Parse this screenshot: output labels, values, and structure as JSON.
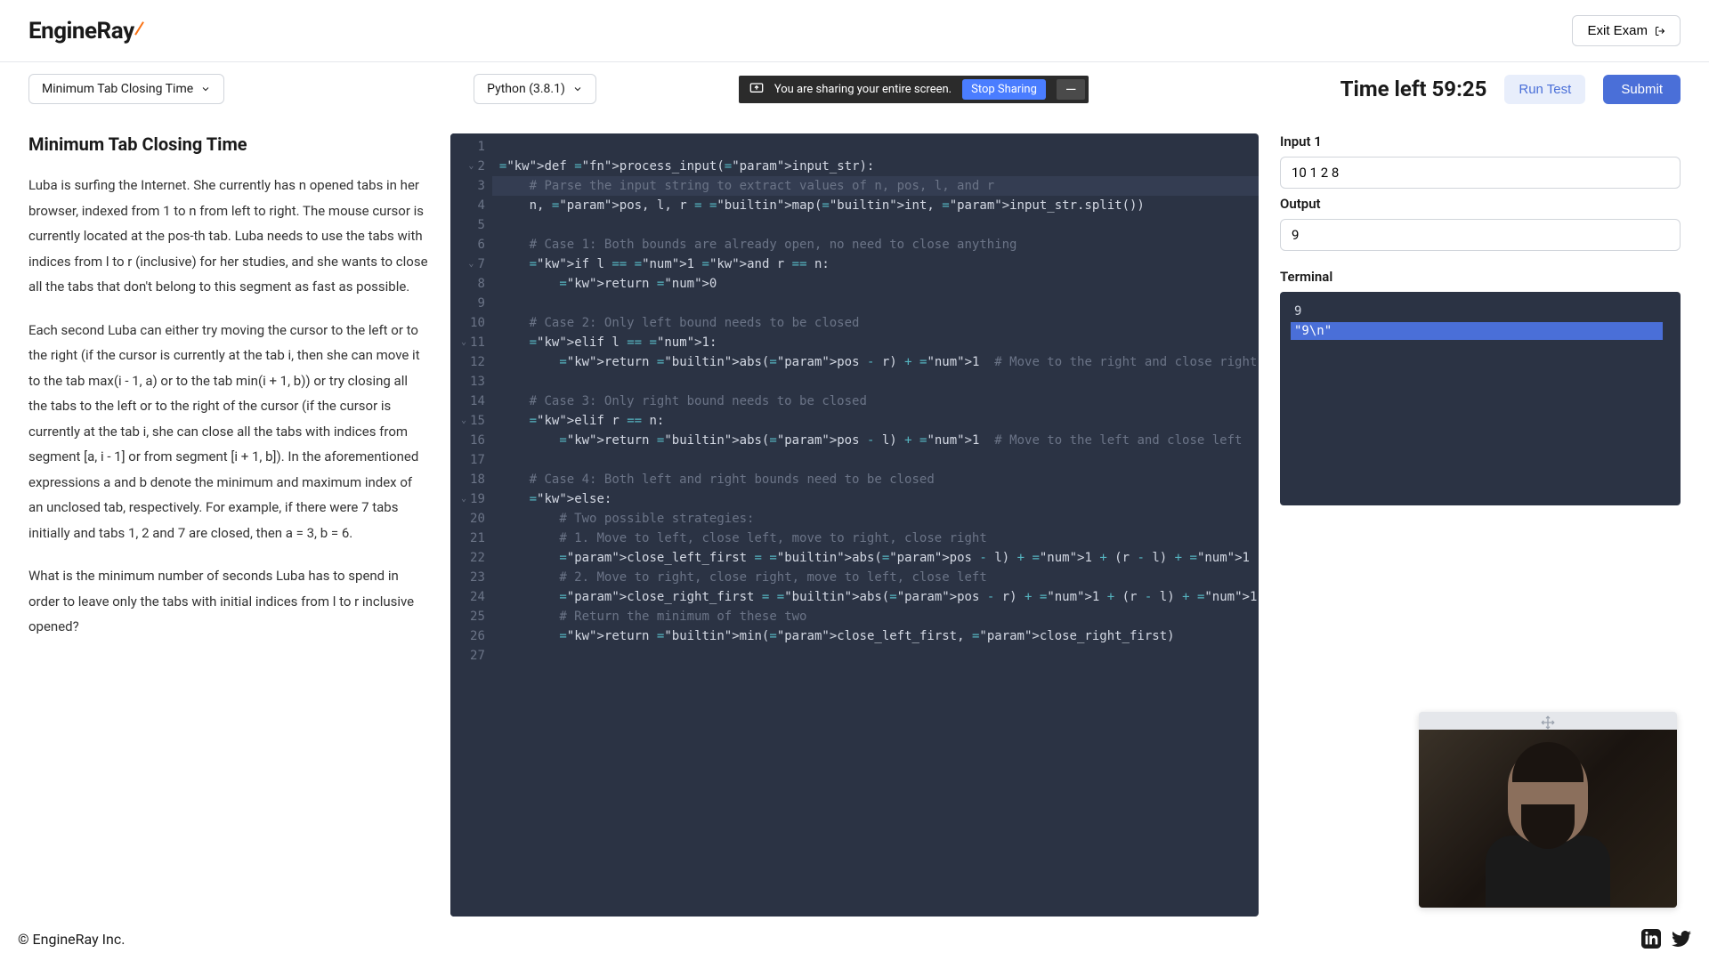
{
  "brand": {
    "name_a": "EngineRa",
    "name_b": "y"
  },
  "header": {
    "exit_label": "Exit Exam"
  },
  "toolbar": {
    "problem_dropdown": "Minimum Tab Closing Time",
    "language_dropdown": "Python (3.8.1)",
    "share_text": "You are sharing your entire screen.",
    "stop_sharing": "Stop Sharing",
    "time_prefix": "Time left ",
    "time_value": "59:25",
    "run_test": "Run Test",
    "submit": "Submit"
  },
  "problem": {
    "title": "Minimum Tab Closing Time",
    "p1": "Luba is surfing the Internet. She currently has n opened tabs in her browser, indexed from 1 to n from left to right. The mouse cursor is currently located at the pos-th tab. Luba needs to use the tabs with indices from l to r (inclusive) for her studies, and she wants to close all the tabs that don't belong to this segment as fast as possible.",
    "p2": "Each second Luba can either try moving the cursor to the left or to the right (if the cursor is currently at the tab i, then she can move it to the tab max(i - 1, a) or to the tab min(i + 1, b)) or try closing all the tabs to the left or to the right of the cursor (if the cursor is currently at the tab i, she can close all the tabs with indices from segment [a, i - 1] or from segment [i + 1, b]). In the aforementioned expressions a and b denote the minimum and maximum index of an unclosed tab, respectively. For example, if there were 7 tabs initially and tabs 1, 2 and 7 are closed, then a = 3, b = 6.",
    "p3": "What is the minimum number of seconds Luba has to spend in order to leave only the tabs with initial indices from l to r inclusive opened?"
  },
  "code": {
    "lines": [
      "",
      "def process_input(input_str):",
      "    # Parse the input string to extract values of n, pos, l, and r",
      "    n, pos, l, r = map(int, input_str.split())",
      "",
      "    # Case 1: Both bounds are already open, no need to close anything",
      "    if l == 1 and r == n:",
      "        return 0",
      "",
      "    # Case 2: Only left bound needs to be closed",
      "    elif l == 1:",
      "        return abs(pos - r) + 1  # Move to the right and close right",
      "",
      "    # Case 3: Only right bound needs to be closed",
      "    elif r == n:",
      "        return abs(pos - l) + 1  # Move to the left and close left",
      "",
      "    # Case 4: Both left and right bounds need to be closed",
      "    else:",
      "        # Two possible strategies:",
      "        # 1. Move to left, close left, move to right, close right",
      "        close_left_first = abs(pos - l) + 1 + (r - l) + 1",
      "        # 2. Move to right, close right, move to left, close left",
      "        close_right_first = abs(pos - r) + 1 + (r - l) + 1",
      "        # Return the minimum of these two",
      "        return min(close_left_first, close_right_first)",
      ""
    ]
  },
  "io": {
    "input_label": "Input 1",
    "input_value": "10 1 2 8",
    "output_label": "Output",
    "output_value": "9",
    "terminal_label": "Terminal",
    "terminal_line1": "9",
    "terminal_line2": "\"9\\n\""
  },
  "footer": {
    "copyright": "© EngineRay Inc."
  }
}
